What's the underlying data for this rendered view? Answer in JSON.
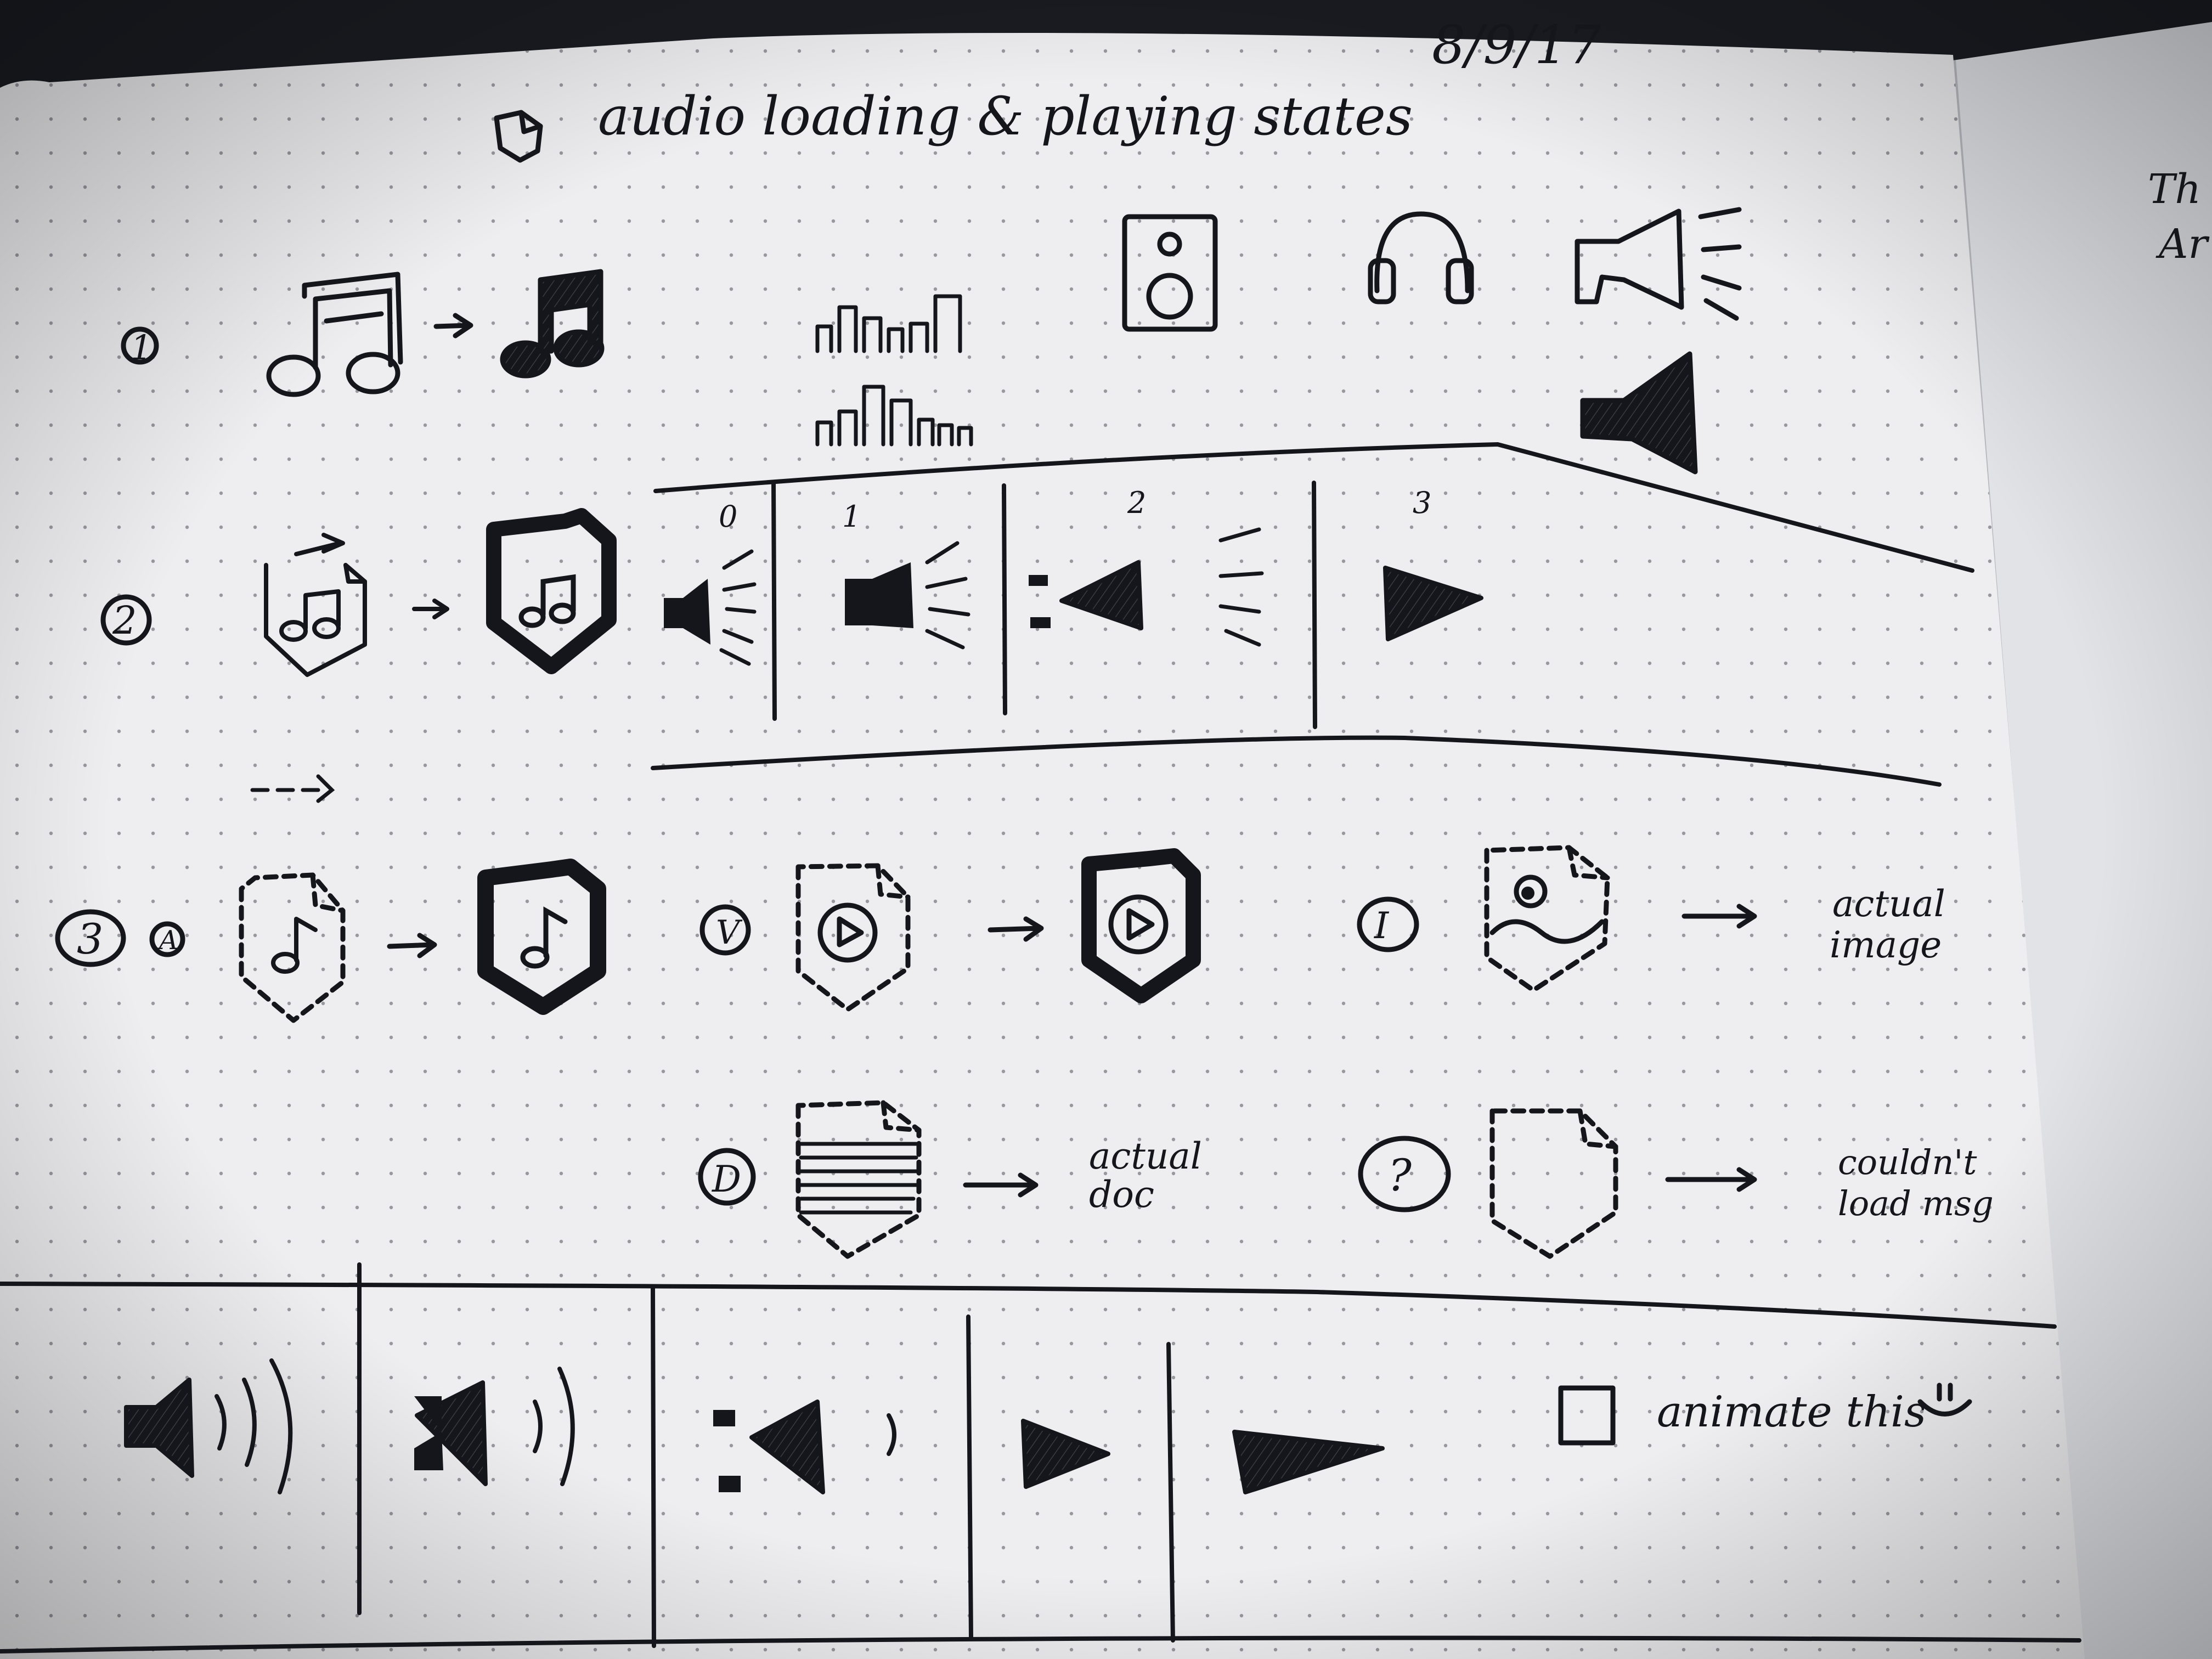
{
  "page": {
    "title": "audio loading & playing states",
    "date": "8/9/17"
  },
  "row_labels": {
    "row1": "1",
    "row2": "2",
    "row3": "3",
    "sub_a": "A",
    "sub_v": "V",
    "sub_i": "I",
    "sub_d": "D",
    "sub_q": "?"
  },
  "frame_numbers": [
    "0",
    "1",
    "2",
    "3"
  ],
  "notes": {
    "actual_image_1": "actual",
    "actual_image_2": "image",
    "actual_doc_1": "actual",
    "actual_doc_2": "doc",
    "couldnt_load_1": "couldn't",
    "couldnt_load_2": "load msg",
    "animate_this": "animate this",
    "edge_text_1": "Th",
    "edge_text_2": "Ar"
  },
  "colors": {
    "ink": "#15151c",
    "paper": "#eeeef0",
    "paper_shadow": "#c9cbd0",
    "dots": "#8d8f96",
    "background": "#1a1c22"
  },
  "icons": [
    "music-note-outline-icon",
    "music-note-filled-icon",
    "equalizer-bars-icon",
    "speaker-box-icon",
    "headphones-icon",
    "megaphone-icon",
    "speaker-cone-icon",
    "audio-file-icon",
    "play-triangle-icon",
    "video-file-icon",
    "image-file-icon",
    "document-file-icon",
    "question-icon",
    "blank-file-icon",
    "square-icon",
    "smiley-icon"
  ]
}
